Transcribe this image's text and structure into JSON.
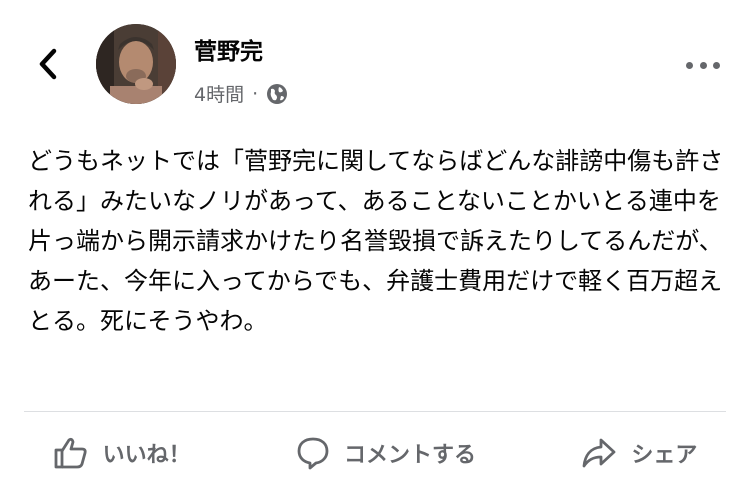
{
  "header": {
    "back_icon": "chevron-left-icon",
    "author_name": "菅野完",
    "timestamp": "4時間",
    "separator": "·",
    "privacy_icon": "globe-icon",
    "more_icon": "more-dots-icon"
  },
  "post": {
    "text": "どうもネットでは「菅野完に関してならばどんな誹謗中傷も許される」みたいなノリがあって、あることないことかいとる連中を片っ端から開示請求かけたり名誉毀損で訴えたりしてるんだが、あーた、今年に入ってからでも、弁護士費用だけで軽く百万超えとる。死にそうやわ。"
  },
  "actions": {
    "like_label": "いいね！",
    "comment_label": "コメントする",
    "share_label": "シェア"
  },
  "colors": {
    "text": "#050505",
    "secondary": "#65676b",
    "divider": "#dddfe2"
  }
}
